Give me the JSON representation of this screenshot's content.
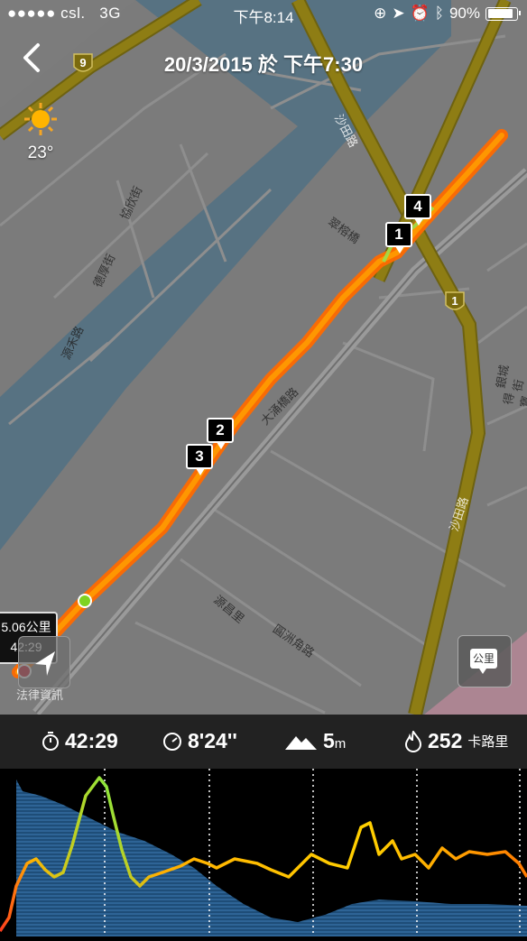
{
  "status_bar": {
    "carrier": "●●●●● csl.",
    "network": "3G",
    "time": "下午8:14",
    "battery_percent": "90%",
    "battery_level": 0.9
  },
  "header": {
    "title": "20/3/2015 於 下午7:30"
  },
  "weather": {
    "temperature": "23°",
    "icon": "sun-icon"
  },
  "map": {
    "road_labels": [
      "沙田路",
      "沙田路",
      "大涌橋路",
      "源昌里",
      "圓洲角路",
      "協欣街",
      "德厚街",
      "源禾路",
      "銀城街",
      "得寶",
      "翠榕橋"
    ],
    "route_shields": [
      "9",
      "1"
    ],
    "split_markers": [
      "1",
      "2",
      "3",
      "4"
    ],
    "end_label": {
      "distance": "5.06公里",
      "time": "42:29"
    },
    "nav_button_label": "法律資訊",
    "unit_button_label": "公里",
    "colors": {
      "water": "#567180",
      "land": "#7b7b7b",
      "highway": "#8c7a12",
      "route_fast": "#ff8a00",
      "route_slow": "#ff5200"
    }
  },
  "stats": {
    "duration": "42:29",
    "pace": "8'24''",
    "elevation_value": "5",
    "elevation_unit": "m",
    "calories_value": "252",
    "calories_unit": "卡路里"
  }
}
